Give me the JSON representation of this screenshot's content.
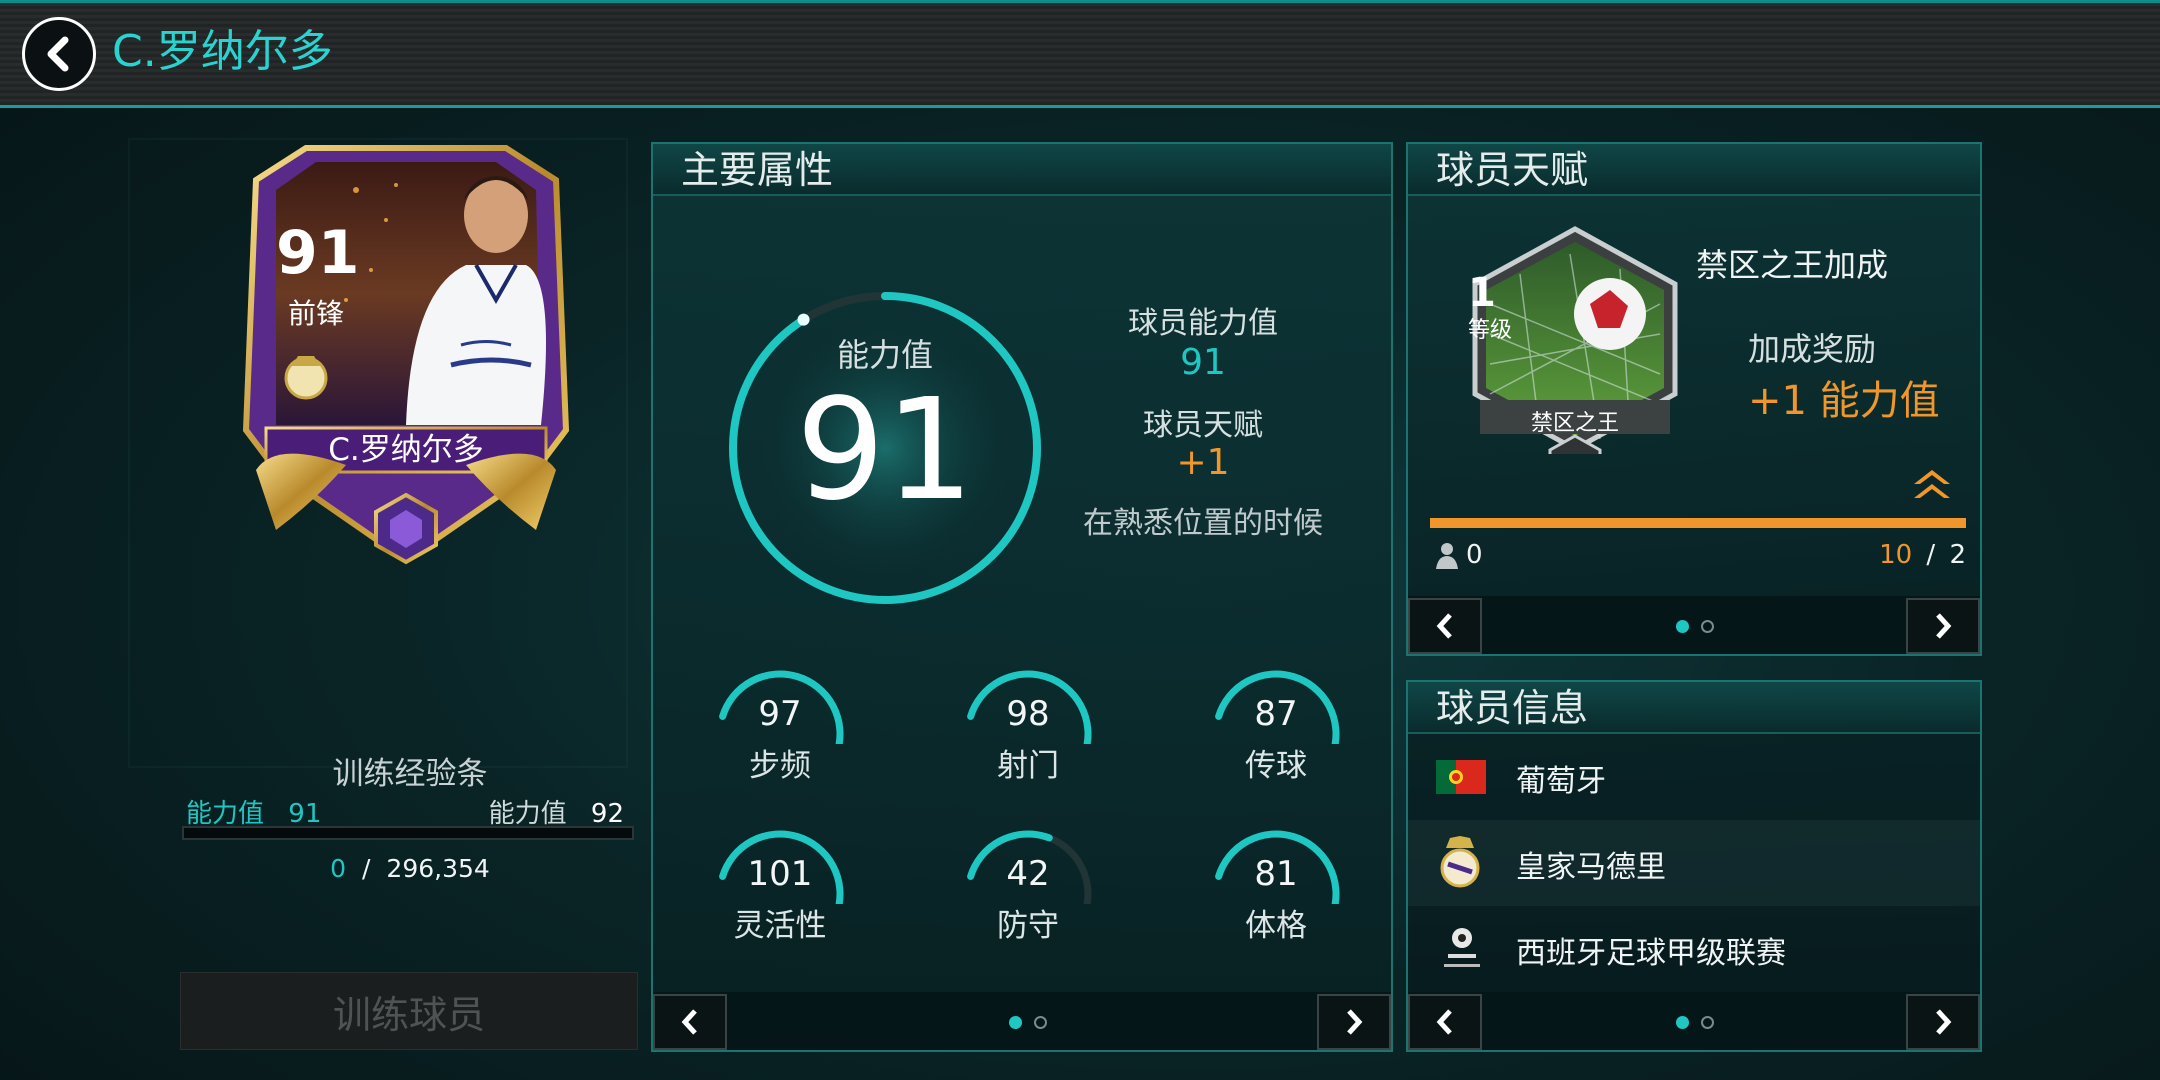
{
  "header": {
    "title": "C.罗纳尔多"
  },
  "card": {
    "rating": "91",
    "position": "前锋",
    "name": "C.罗纳尔多"
  },
  "training": {
    "title": "训练经验条",
    "current_label": "能力值",
    "current_value": "91",
    "next_label": "能力值",
    "next_value": "92",
    "progress_current": "0",
    "progress_sep": "/",
    "progress_total": "296,354",
    "progress_fraction": 0,
    "button_label": "训练球员"
  },
  "attributes": {
    "heading": "主要属性",
    "ovr_label": "能力值",
    "ovr_value": "91",
    "ovr_fraction": 0.91,
    "player_rating_label": "球员能力值",
    "player_rating_value": "91",
    "talent_label": "球员天赋",
    "talent_value": "+1",
    "talent_note": "在熟悉位置的时候",
    "stats": [
      {
        "value": "97",
        "label": "步频",
        "fraction": 0.97
      },
      {
        "value": "98",
        "label": "射门",
        "fraction": 0.98
      },
      {
        "value": "87",
        "label": "传球",
        "fraction": 0.87
      },
      {
        "value": "101",
        "label": "灵活性",
        "fraction": 1.0
      },
      {
        "value": "42",
        "label": "防守",
        "fraction": 0.42
      },
      {
        "value": "81",
        "label": "体格",
        "fraction": 0.81
      }
    ],
    "page": 1,
    "pages": 2
  },
  "talent": {
    "heading": "球员天赋",
    "badge_level": "1",
    "badge_level_label": "等级",
    "badge_name": "禁区之王",
    "bonus_title": "禁区之王加成",
    "reward_label": "加成奖励",
    "reward_value": "+1 能力值",
    "progress_left": "0",
    "progress_current": "10",
    "progress_sep": "/",
    "progress_total": "2",
    "progress_fraction": 1.0,
    "page": 1,
    "pages": 2
  },
  "info": {
    "heading": "球员信息",
    "rows": [
      {
        "icon": "portugal-flag-icon",
        "text": "葡萄牙"
      },
      {
        "icon": "real-madrid-crest-icon",
        "text": "皇家马德里"
      },
      {
        "icon": "laliga-logo-icon",
        "text": "西班牙足球甲级联赛"
      }
    ],
    "page": 1,
    "pages": 2
  },
  "colors": {
    "teal": "#1fc7c3",
    "orange": "#f0962a",
    "panel_border": "#1b7470",
    "purple": "#6a2fa6"
  }
}
